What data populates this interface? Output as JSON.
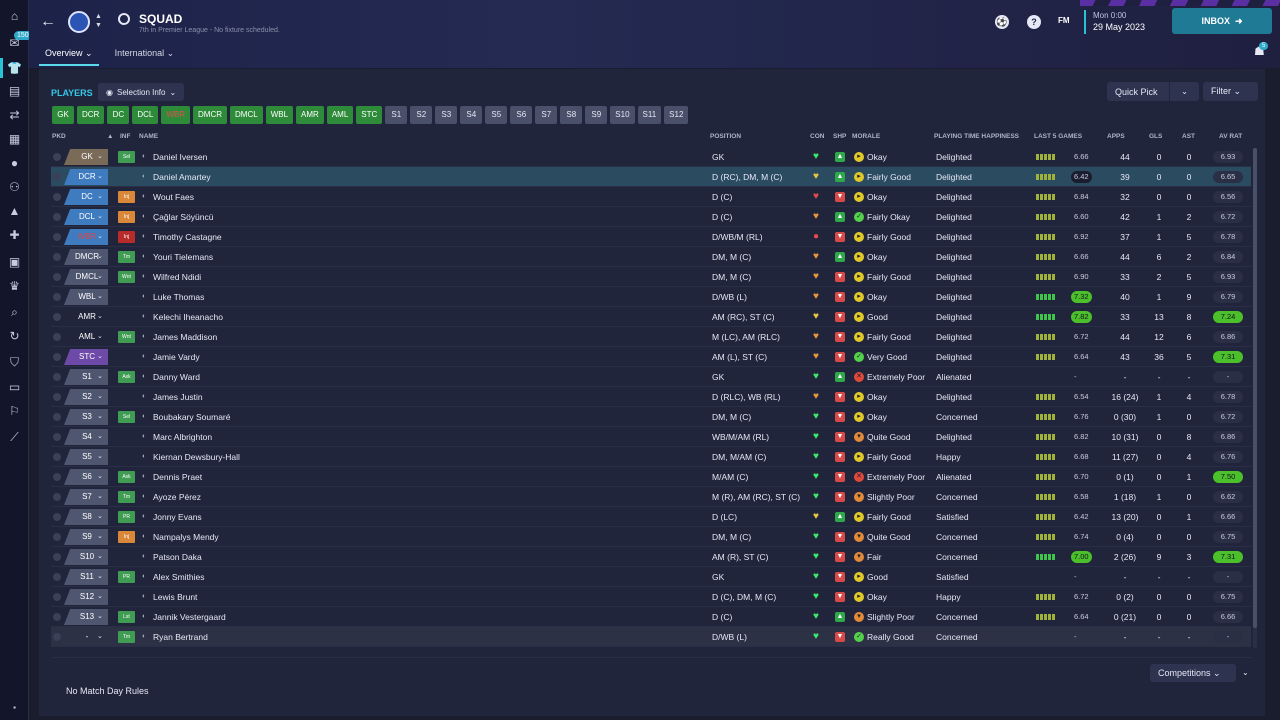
{
  "header": {
    "title": "SQUAD",
    "subtitle": "7th in Premier League - No fixture scheduled.",
    "tabs": [
      "Overview ⌄",
      "International ⌄"
    ],
    "fm_logo": "FM",
    "date_day": "Mon 0:00",
    "date": "29 May 2023",
    "inbox": "INBOX",
    "sidebar_badge": "150",
    "notif_badge": "5"
  },
  "toolbar": {
    "players_title": "PLAYERS",
    "selection_info": "Selection Info",
    "quick_pick": "Quick Pick",
    "filter": "Filter"
  },
  "position_chips": [
    {
      "label": "GK",
      "style": "g"
    },
    {
      "label": "DCR",
      "style": "g"
    },
    {
      "label": "DC",
      "style": "g"
    },
    {
      "label": "DCL",
      "style": "g"
    },
    {
      "label": "WBR",
      "style": "gr"
    },
    {
      "label": "DMCR",
      "style": "g"
    },
    {
      "label": "DMCL",
      "style": "g"
    },
    {
      "label": "WBL",
      "style": "g"
    },
    {
      "label": "AMR",
      "style": "g"
    },
    {
      "label": "AML",
      "style": "g"
    },
    {
      "label": "STC",
      "style": "g"
    },
    {
      "label": "S1",
      "style": "s"
    },
    {
      "label": "S2",
      "style": "s"
    },
    {
      "label": "S3",
      "style": "s"
    },
    {
      "label": "S4",
      "style": "s"
    },
    {
      "label": "S5",
      "style": "s"
    },
    {
      "label": "S6",
      "style": "s"
    },
    {
      "label": "S7",
      "style": "s"
    },
    {
      "label": "S8",
      "style": "s"
    },
    {
      "label": "S9",
      "style": "s"
    },
    {
      "label": "S10",
      "style": "s"
    },
    {
      "label": "S11",
      "style": "s"
    },
    {
      "label": "S12",
      "style": "s"
    }
  ],
  "columns": {
    "pkd": "PKD",
    "sort": "▲",
    "inf": "INF",
    "name": "NAME",
    "position": "POSITION",
    "con": "CON",
    "shp": "SHP",
    "morale": "MORALE",
    "pth": "PLAYING TIME HAPPINESS",
    "l5": "LAST 5 GAMES",
    "apps": "APPS",
    "gls": "GLS",
    "ast": "AST",
    "avr": "AV RAT"
  },
  "rows": [
    {
      "pkd": "GK",
      "t": "gk",
      "inf": "Sel",
      "ic": "g",
      "name": "Daniel Iversen",
      "pos": "GK",
      "con": "g",
      "shp": "g",
      "mi": "y",
      "morale": "Okay",
      "pth": "Delighted",
      "l5": "6.66",
      "l5c": "",
      "apps": "44",
      "gls": "0",
      "ast": "0",
      "avr": "6.93",
      "ah": false
    },
    {
      "pkd": "DCR",
      "t": "def",
      "inf": "",
      "ic": "",
      "name": "Daniel Amartey",
      "pos": "D (RC), DM, M (C)",
      "con": "y",
      "shp": "g",
      "mi": "y",
      "morale": "Fairly Good",
      "pth": "Delighted",
      "l5": "6.42",
      "l5c": "sel-b",
      "apps": "39",
      "gls": "0",
      "ast": "0",
      "avr": "6.65",
      "ah": false
    },
    {
      "pkd": "DC",
      "t": "def",
      "inf": "Inj",
      "ic": "o",
      "name": "Wout Faes",
      "pos": "D (C)",
      "con": "r",
      "shp": "r",
      "mi": "y",
      "morale": "Okay",
      "pth": "Delighted",
      "l5": "6.84",
      "l5c": "",
      "apps": "32",
      "gls": "0",
      "ast": "0",
      "avr": "6.56",
      "ah": false
    },
    {
      "pkd": "DCL",
      "t": "def",
      "inf": "Inj",
      "ic": "o",
      "name": "Çağlar Söyüncü",
      "pos": "D (C)",
      "con": "o",
      "shp": "g",
      "mi": "g",
      "morale": "Fairly Okay",
      "pth": "Delighted",
      "l5": "6.60",
      "l5c": "",
      "apps": "42",
      "gls": "1",
      "ast": "2",
      "avr": "6.72",
      "ah": false
    },
    {
      "pkd": "WBR",
      "t": "def",
      "red": true,
      "inf": "Inj",
      "ic": "r",
      "name": "Timothy Castagne",
      "pos": "D/WB/M (RL)",
      "con": "d",
      "shp": "r",
      "mi": "y",
      "morale": "Fairly Good",
      "pth": "Delighted",
      "l5": "6.92",
      "l5c": "",
      "apps": "37",
      "gls": "1",
      "ast": "5",
      "avr": "6.78",
      "ah": false
    },
    {
      "pkd": "DMCR",
      "t": "mid",
      "inf": "Tm",
      "ic": "g",
      "name": "Youri Tielemans",
      "pos": "DM, M (C)",
      "con": "o",
      "shp": "g",
      "mi": "y",
      "morale": "Okay",
      "pth": "Delighted",
      "l5": "6.66",
      "l5c": "",
      "apps": "44",
      "gls": "6",
      "ast": "2",
      "avr": "6.84",
      "ah": false
    },
    {
      "pkd": "DMCL",
      "t": "mid",
      "inf": "Wnt",
      "ic": "g",
      "name": "Wilfred Ndidi",
      "pos": "DM, M (C)",
      "con": "o",
      "shp": "r",
      "mi": "y",
      "morale": "Fairly Good",
      "pth": "Delighted",
      "l5": "6.90",
      "l5c": "",
      "apps": "33",
      "gls": "2",
      "ast": "5",
      "avr": "6.93",
      "ah": false
    },
    {
      "pkd": "WBL",
      "t": "mid",
      "inf": "",
      "ic": "",
      "name": "Luke Thomas",
      "pos": "D/WB (L)",
      "con": "o",
      "shp": "r",
      "mi": "y",
      "morale": "Okay",
      "pth": "Delighted",
      "l5": "7.32",
      "l5c": "hi",
      "apps": "40",
      "gls": "1",
      "ast": "9",
      "avr": "6.79",
      "ah": false
    },
    {
      "pkd": "AMR",
      "t": "none",
      "inf": "",
      "ic": "",
      "name": "Kelechi Iheanacho",
      "pos": "AM (RC), ST (C)",
      "con": "y",
      "shp": "r",
      "mi": "y",
      "morale": "Good",
      "pth": "Delighted",
      "l5": "7.82",
      "l5c": "hi",
      "apps": "33",
      "gls": "13",
      "ast": "8",
      "avr": "7.24",
      "ah": true
    },
    {
      "pkd": "AML",
      "t": "none",
      "inf": "Wnt",
      "ic": "g",
      "name": "James Maddison",
      "pos": "M (LC), AM (RLC)",
      "con": "o",
      "shp": "r",
      "mi": "y",
      "morale": "Fairly Good",
      "pth": "Delighted",
      "l5": "6.72",
      "l5c": "",
      "apps": "44",
      "gls": "12",
      "ast": "6",
      "avr": "6.86",
      "ah": false
    },
    {
      "pkd": "STC",
      "t": "att",
      "inf": "",
      "ic": "",
      "name": "Jamie Vardy",
      "pos": "AM (L), ST (C)",
      "con": "o",
      "shp": "r",
      "mi": "g",
      "morale": "Very Good",
      "pth": "Delighted",
      "l5": "6.64",
      "l5c": "",
      "apps": "43",
      "gls": "36",
      "ast": "5",
      "avr": "7.31",
      "ah": true
    },
    {
      "pkd": "S1",
      "t": "sub",
      "inf": "Ask",
      "ic": "g",
      "name": "Danny Ward",
      "pos": "GK",
      "con": "g",
      "shp": "g",
      "mi": "r",
      "morale": "Extremely Poor",
      "pth": "Alienated",
      "l5": "-",
      "l5c": "",
      "apps": "-",
      "gls": "-",
      "ast": "-",
      "avr": "-",
      "ah": false
    },
    {
      "pkd": "S2",
      "t": "sub",
      "inf": "",
      "ic": "",
      "name": "James Justin",
      "pos": "D (RLC), WB (RL)",
      "con": "o",
      "shp": "r",
      "mi": "y",
      "morale": "Okay",
      "pth": "Delighted",
      "l5": "6.54",
      "l5c": "",
      "apps": "16 (24)",
      "gls": "1",
      "ast": "4",
      "avr": "6.78",
      "ah": false
    },
    {
      "pkd": "S3",
      "t": "sub",
      "inf": "Sel",
      "ic": "g",
      "name": "Boubakary Soumaré",
      "pos": "DM, M (C)",
      "con": "g",
      "shp": "r",
      "mi": "y",
      "morale": "Okay",
      "pth": "Concerned",
      "l5": "6.76",
      "l5c": "",
      "apps": "0 (30)",
      "gls": "1",
      "ast": "0",
      "avr": "6.72",
      "ah": false
    },
    {
      "pkd": "S4",
      "t": "sub",
      "inf": "",
      "ic": "",
      "name": "Marc Albrighton",
      "pos": "WB/M/AM (RL)",
      "con": "g",
      "shp": "r",
      "mi": "o",
      "morale": "Quite Good",
      "pth": "Delighted",
      "l5": "6.82",
      "l5c": "",
      "apps": "10 (31)",
      "gls": "0",
      "ast": "8",
      "avr": "6.86",
      "ah": false
    },
    {
      "pkd": "S5",
      "t": "sub",
      "inf": "",
      "ic": "",
      "name": "Kiernan Dewsbury-Hall",
      "pos": "DM, M/AM (C)",
      "con": "g",
      "shp": "r",
      "mi": "y",
      "morale": "Fairly Good",
      "pth": "Happy",
      "l5": "6.68",
      "l5c": "",
      "apps": "11 (27)",
      "gls": "0",
      "ast": "4",
      "avr": "6.76",
      "ah": false
    },
    {
      "pkd": "S6",
      "t": "sub",
      "inf": "Ask",
      "ic": "g",
      "name": "Dennis Praet",
      "pos": "M/AM (C)",
      "con": "g",
      "shp": "r",
      "mi": "r",
      "morale": "Extremely Poor",
      "pth": "Alienated",
      "l5": "6.70",
      "l5c": "",
      "apps": "0 (1)",
      "gls": "0",
      "ast": "1",
      "avr": "7.50",
      "ah": true
    },
    {
      "pkd": "S7",
      "t": "sub",
      "inf": "Tm",
      "ic": "g",
      "name": "Ayoze Pérez",
      "pos": "M (R), AM (RC), ST (C)",
      "con": "g",
      "shp": "r",
      "mi": "o",
      "morale": "Slightly Poor",
      "pth": "Concerned",
      "l5": "6.58",
      "l5c": "",
      "apps": "1 (18)",
      "gls": "1",
      "ast": "0",
      "avr": "6.62",
      "ah": false
    },
    {
      "pkd": "S8",
      "t": "sub",
      "inf": "PR",
      "ic": "g",
      "name": "Jonny Evans",
      "pos": "D (LC)",
      "con": "y",
      "shp": "g",
      "mi": "y",
      "morale": "Fairly Good",
      "pth": "Satisfied",
      "l5": "6.42",
      "l5c": "",
      "apps": "13 (20)",
      "gls": "0",
      "ast": "1",
      "avr": "6.66",
      "ah": false
    },
    {
      "pkd": "S9",
      "t": "sub",
      "inf": "Inj",
      "ic": "o",
      "name": "Nampalys Mendy",
      "pos": "DM, M (C)",
      "con": "g",
      "shp": "r",
      "mi": "o",
      "morale": "Quite Good",
      "pth": "Concerned",
      "l5": "6.74",
      "l5c": "",
      "apps": "0 (4)",
      "gls": "0",
      "ast": "0",
      "avr": "6.75",
      "ah": false
    },
    {
      "pkd": "S10",
      "t": "sub",
      "inf": "",
      "ic": "",
      "name": "Patson Daka",
      "pos": "AM (R), ST (C)",
      "con": "g",
      "shp": "r",
      "mi": "o",
      "morale": "Fair",
      "pth": "Concerned",
      "l5": "7.00",
      "l5c": "hi",
      "apps": "2 (26)",
      "gls": "9",
      "ast": "3",
      "avr": "7.31",
      "ah": true
    },
    {
      "pkd": "S11",
      "t": "sub",
      "inf": "PR",
      "ic": "g",
      "name": "Alex Smithies",
      "pos": "GK",
      "con": "g",
      "shp": "r",
      "mi": "y",
      "morale": "Good",
      "pth": "Satisfied",
      "l5": "-",
      "l5c": "",
      "apps": "-",
      "gls": "-",
      "ast": "-",
      "avr": "-",
      "ah": false
    },
    {
      "pkd": "S12",
      "t": "sub",
      "inf": "",
      "ic": "",
      "name": "Lewis Brunt",
      "pos": "D (C), DM, M (C)",
      "con": "g",
      "shp": "r",
      "mi": "y",
      "morale": "Okay",
      "pth": "Happy",
      "l5": "6.72",
      "l5c": "",
      "apps": "0 (2)",
      "gls": "0",
      "ast": "0",
      "avr": "6.75",
      "ah": false
    },
    {
      "pkd": "S13",
      "t": "sub",
      "inf": "Lst",
      "ic": "g",
      "name": "Jannik Vestergaard",
      "pos": "D (C)",
      "con": "g",
      "shp": "g",
      "mi": "o",
      "morale": "Slightly Poor",
      "pth": "Concerned",
      "l5": "6.64",
      "l5c": "",
      "apps": "0 (21)",
      "gls": "0",
      "ast": "0",
      "avr": "6.66",
      "ah": false
    },
    {
      "pkd": "-",
      "t": "none",
      "inf": "Tm",
      "ic": "g",
      "name": "Ryan Bertrand",
      "pos": "D/WB (L)",
      "con": "g",
      "shp": "r",
      "mi": "g",
      "morale": "Really Good",
      "pth": "Concerned",
      "l5": "-",
      "l5c": "",
      "apps": "-",
      "gls": "-",
      "ast": "-",
      "avr": "-",
      "ah": false,
      "grey": true
    }
  ],
  "footer": {
    "no_rules": "No Match Day Rules",
    "competitions": "Competitions"
  }
}
